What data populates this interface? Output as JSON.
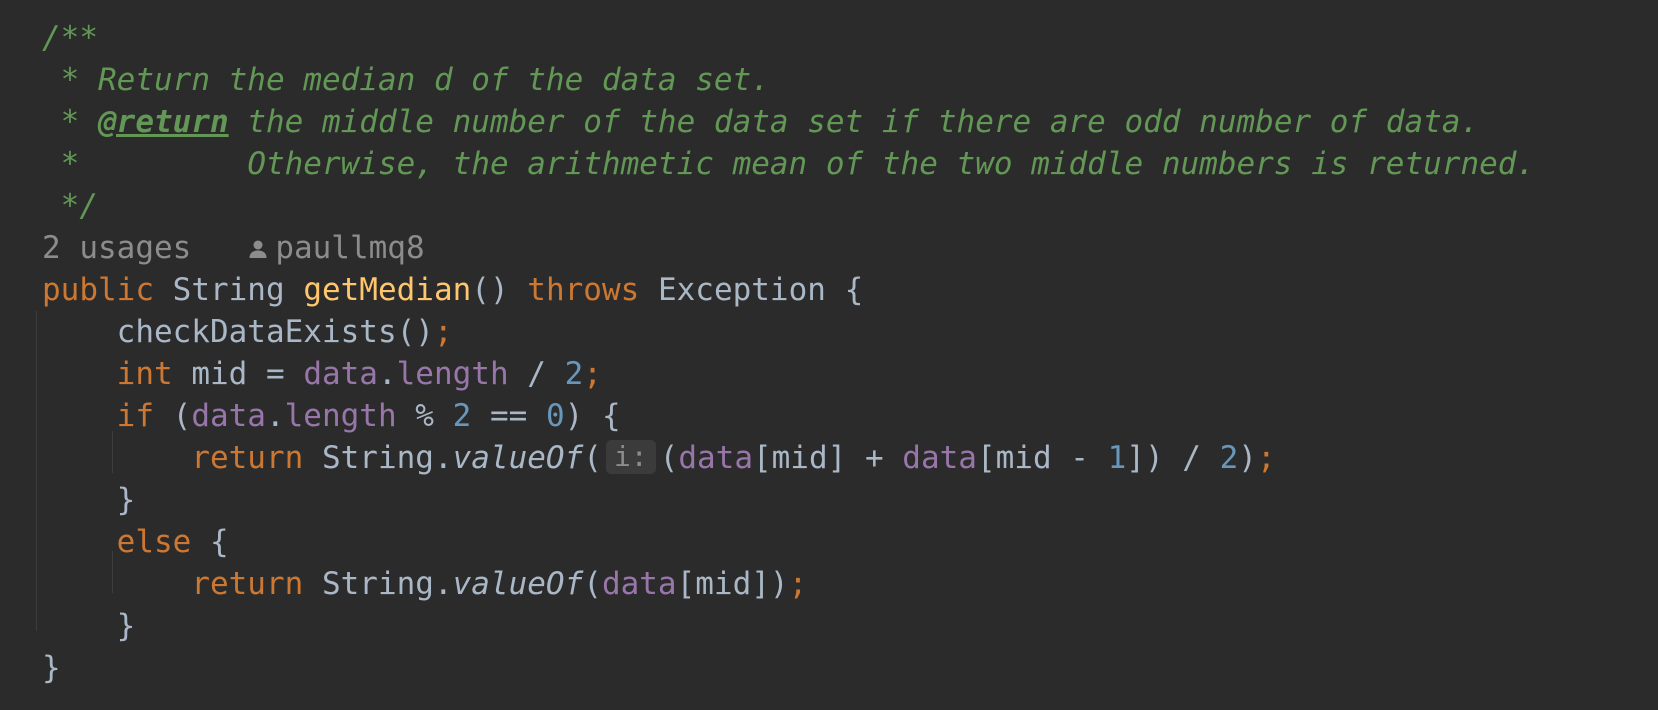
{
  "javadoc": {
    "open": "/**",
    "line1_prefix": " * ",
    "line1_text": "Return the median d of the data set.",
    "line2_prefix": " * ",
    "line2_tag": "@return",
    "line2_text": " the middle number of the data set if there are odd number of data.",
    "line3_prefix": " *         ",
    "line3_text": "Otherwise, the arithmetic mean of the two middle numbers is returned.",
    "close": " */"
  },
  "inlay": {
    "usages": "2 usages",
    "author": "paullmq8",
    "author_icon": "person-icon"
  },
  "code": {
    "sig_public": "public",
    "sig_type": "String",
    "sig_name": "getMedian",
    "sig_parens": "()",
    "sig_throws": "throws",
    "sig_exception": "Exception",
    "sig_brace": "{",
    "l1_call": "checkDataExists()",
    "semicolon": ";",
    "l2_int": "int",
    "l2_mid": " mid = ",
    "data": "data",
    "dot": ".",
    "length": "length",
    "l2_div": " / ",
    "two": "2",
    "l3_if": "if",
    "l3_open": " (",
    "l3_mod": " % ",
    "l3_eq": " == ",
    "zero": "0",
    "l3_close": ") {",
    "return_kw": "return",
    "string_cls": " String.",
    "value_of": "valueOf",
    "open_paren": "(",
    "param_hint": "i:",
    "l4_rest1": "(",
    "l4_idx1": "[mid] + ",
    "l4_idx2": "[mid - ",
    "one": "1",
    "l4_close1": "]) / ",
    "l4_close2": ")",
    "close_brace": "}",
    "else_kw": "else",
    "else_brace": " {",
    "l7_idx": "[mid])"
  }
}
